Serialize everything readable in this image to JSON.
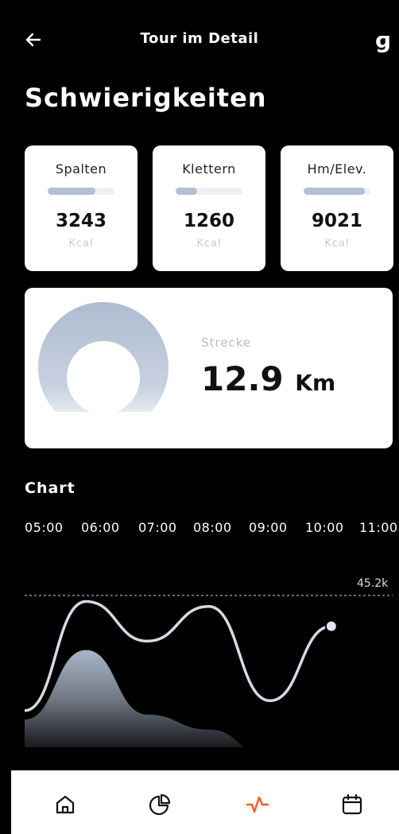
{
  "header": {
    "title": "Tour im Detail",
    "logo": "ɡ"
  },
  "page_title": "Schwierigkeiten",
  "stats": [
    {
      "label": "Spalten",
      "value": "3243",
      "unit": "Kcal",
      "progress": 0.72
    },
    {
      "label": "Klettern",
      "value": "1260",
      "unit": "Kcal",
      "progress": 0.32
    },
    {
      "label": "Hm/Elev.",
      "value": "9021",
      "unit": "Kcal",
      "progress": 0.92
    }
  ],
  "distance": {
    "label": "Strecke",
    "value": "12.9",
    "unit": "Km"
  },
  "chart_section": {
    "title": "Chart"
  },
  "chart_data": {
    "type": "area",
    "x": [
      "05:00",
      "06:00",
      "07:00",
      "08:00",
      "09:00",
      "10:00",
      "11:00"
    ],
    "series": [
      {
        "values": [
          1.2,
          2.6,
          1.3,
          1.0,
          0.45,
          0.6,
          0.38
        ]
      },
      {
        "values": [
          0.9,
          3.1,
          2.3,
          3.0,
          1.1,
          2.6
        ]
      }
    ],
    "highlight": {
      "index": 5,
      "label": "45.2k"
    },
    "reference_line": true,
    "grid": false
  },
  "tabbar": {
    "items": [
      {
        "icon": "home-icon",
        "active": false
      },
      {
        "icon": "pie-chart-icon",
        "active": false
      },
      {
        "icon": "activity-icon",
        "active": true
      },
      {
        "icon": "calendar-icon",
        "active": false
      }
    ],
    "colors": {
      "active": "#ff5a1f",
      "inactive": "#111111"
    }
  }
}
